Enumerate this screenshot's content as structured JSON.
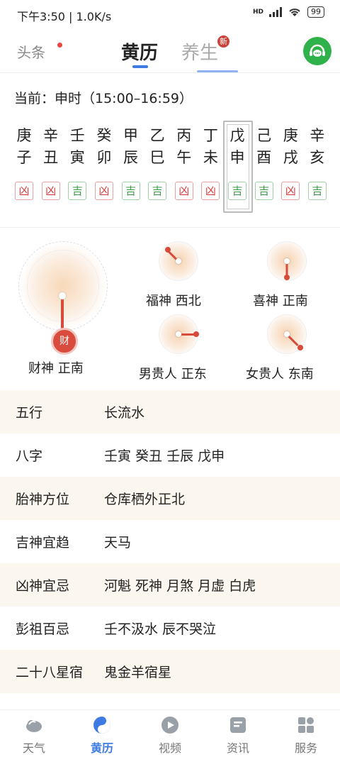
{
  "status_bar": {
    "time_speed": "下午3:50 | 1.0K/s",
    "network": "HD",
    "battery": "99"
  },
  "top_nav": {
    "headlines": "头条",
    "almanac": "黄历",
    "health": "养生",
    "new_badge": "新"
  },
  "current_hour": "当前：申时（15:00–16:59）",
  "hours": [
    {
      "gan": "庚",
      "zhi": "子",
      "luck": "凶",
      "status": "bad"
    },
    {
      "gan": "辛",
      "zhi": "丑",
      "luck": "凶",
      "status": "bad"
    },
    {
      "gan": "壬",
      "zhi": "寅",
      "luck": "吉",
      "status": "good"
    },
    {
      "gan": "癸",
      "zhi": "卯",
      "luck": "凶",
      "status": "bad"
    },
    {
      "gan": "甲",
      "zhi": "辰",
      "luck": "吉",
      "status": "good"
    },
    {
      "gan": "乙",
      "zhi": "巳",
      "luck": "吉",
      "status": "good"
    },
    {
      "gan": "丙",
      "zhi": "午",
      "luck": "凶",
      "status": "bad"
    },
    {
      "gan": "丁",
      "zhi": "未",
      "luck": "凶",
      "status": "bad"
    },
    {
      "gan": "戊",
      "zhi": "申",
      "luck": "吉",
      "status": "good",
      "current": true
    },
    {
      "gan": "己",
      "zhi": "酉",
      "luck": "吉",
      "status": "good"
    },
    {
      "gan": "庚",
      "zhi": "戌",
      "luck": "凶",
      "status": "bad"
    },
    {
      "gan": "辛",
      "zhi": "亥",
      "luck": "吉",
      "status": "good"
    }
  ],
  "gods": {
    "wealth": {
      "label": "财神 正南",
      "badge": "财"
    },
    "fortune": {
      "label": "福神 西北"
    },
    "joy": {
      "label": "喜神 正南"
    },
    "male_noble": {
      "label": "男贵人 正东"
    },
    "female_noble": {
      "label": "女贵人 东南"
    }
  },
  "info_rows": [
    {
      "key": "五行",
      "value": "长流水"
    },
    {
      "key": "八字",
      "value": "壬寅 癸丑 壬辰 戊申"
    },
    {
      "key": "胎神方位",
      "value": "仓库栖外正北"
    },
    {
      "key": "吉神宜趋",
      "value": "天马"
    },
    {
      "key": "凶神宜忌",
      "value": "河魁 死神 月煞 月虚 白虎"
    },
    {
      "key": "彭祖百忌",
      "value": "壬不汲水 辰不哭泣"
    },
    {
      "key": "二十八星宿",
      "value": "鬼金羊宿星"
    }
  ],
  "bottom_nav": [
    {
      "label": "天气",
      "icon": "weather-icon"
    },
    {
      "label": "黄历",
      "icon": "taiji-icon",
      "active": true
    },
    {
      "label": "视频",
      "icon": "video-icon"
    },
    {
      "label": "资讯",
      "icon": "news-icon"
    },
    {
      "label": "服务",
      "icon": "services-icon"
    }
  ],
  "colors": {
    "accent": "#3d7be3",
    "bad": "#d94040",
    "good": "#3c9b4a",
    "row_alt": "#fbf7ef"
  }
}
